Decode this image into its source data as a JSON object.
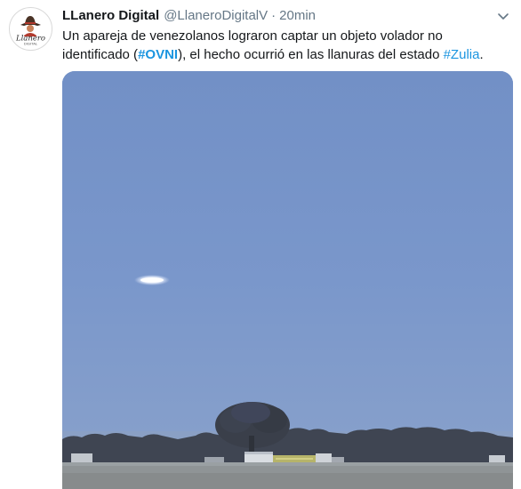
{
  "tweet": {
    "display_name": "LLanero Digital",
    "handle": "@LlaneroDigitalV",
    "separator": "·",
    "time": "20min",
    "text_part1": "Un apareja de venezolanos lograron captar un objeto volador no identificado (",
    "hashtag1": "#OVNI",
    "text_part2": "), el hecho ocurrió en las llanuras del estado ",
    "hashtag2": "#Zulia",
    "text_part3": "."
  },
  "avatar": {
    "logo_text": "Llanero",
    "logo_subtext": "DIGITAL"
  },
  "icons": {
    "more": "chevron-down-icon"
  },
  "colors": {
    "hashtag": "#1b95e0",
    "name": "#14171a",
    "meta": "#657786",
    "sky": "#7c98c8"
  }
}
